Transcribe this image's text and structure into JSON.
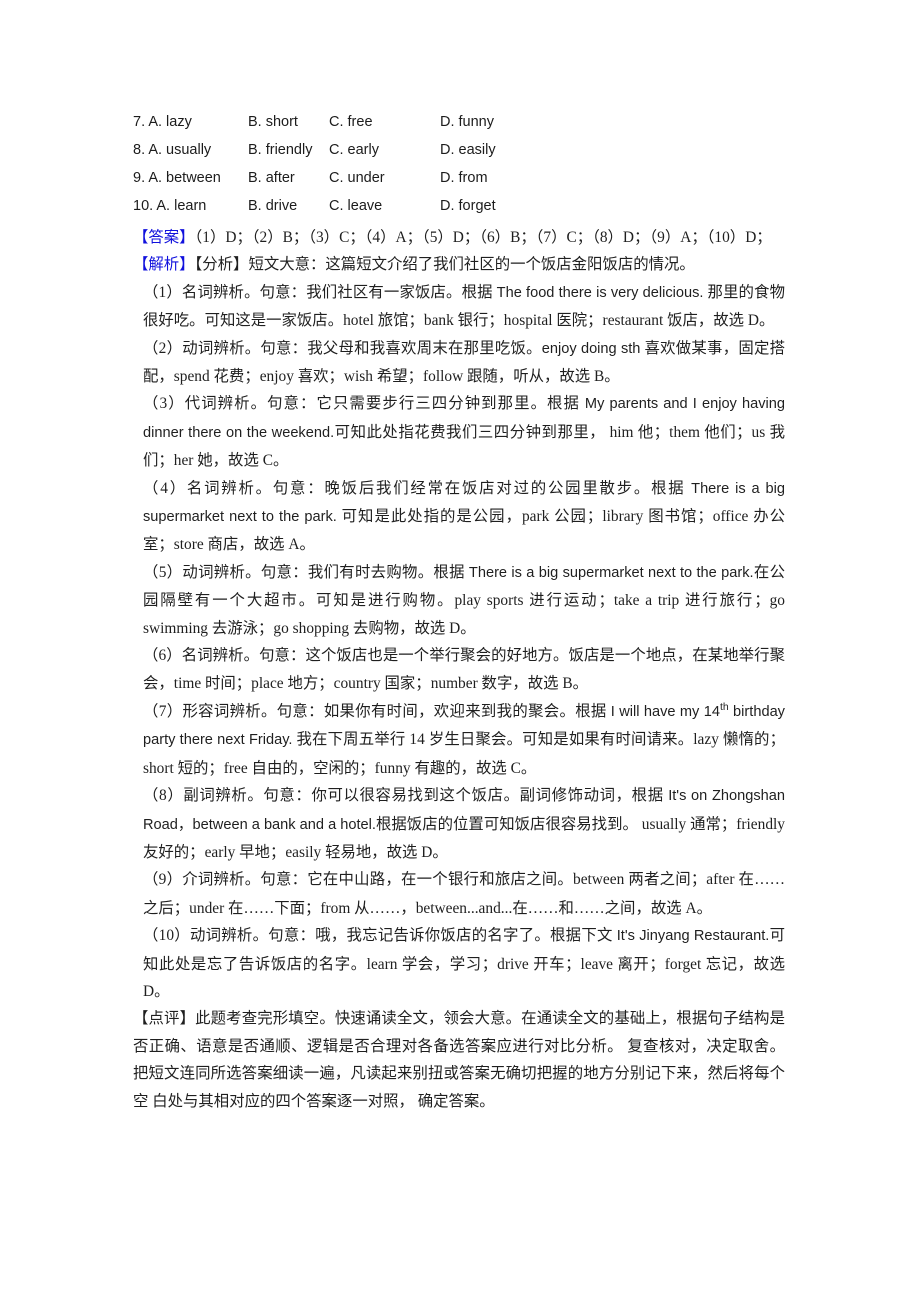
{
  "document": {
    "type": "english-cloze-answer-key",
    "accent_color": "#1111dd",
    "body_color": "#1f1f1f"
  },
  "choices": {
    "rows": [
      {
        "a": "7. A. lazy",
        "b": "B. short",
        "c": "C. free",
        "d": "D. funny"
      },
      {
        "a": "8. A. usually",
        "b": "B. friendly",
        "c": "C. early",
        "d": "D. easily"
      },
      {
        "a": "9. A. between",
        "b": "B. after",
        "c": "C. under",
        "d": "D. from"
      },
      {
        "a": "10. A. learn",
        "b": "B. drive",
        "c": "C. leave",
        "d": "D. forget"
      }
    ]
  },
  "answer_section": {
    "marker": "【答案】",
    "text": "（1）D；（2）B；（3）C；（4）A；（5）D；（6）B；（7）C；（8）D；（9）A；（10）D；"
  },
  "analysis_section": {
    "marker": "【解析】",
    "sub_marker": "【分析】",
    "summary": "短文大意：这篇短文介绍了我们社区的一个饭店金阳饭店的情况。",
    "items": [
      {
        "number": "（1）",
        "text_before": "名词辨析。句意：我们社区有一家饭店。根据 ",
        "quote": "The food there is very delicious.",
        "text_after": " 那里的食物很好吃。可知这是一家饭店。hotel 旅馆；bank 银行；hospital 医院；restaurant 饭店，故选 D。"
      },
      {
        "number": "（2）",
        "text_before": "动词辨析。句意：我父母和我喜欢周末在那里吃饭。",
        "quote": "enjoy doing sth",
        "text_after": " 喜欢做某事，固定搭配，spend 花费；enjoy 喜欢；wish 希望；follow 跟随，听从，故选 B。"
      },
      {
        "number": "（3）",
        "text_before": "代词辨析。句意：它只需要步行三四分钟到那里。根据 ",
        "quote": "My parents and I enjoy having dinner there on the weekend.",
        "text_after": "可知此处指花费我们三四分钟到那里， him 他；them 他们；us 我们；her 她，故选 C。"
      },
      {
        "number": "（4）",
        "text_before": "名词辨析。句意：晚饭后我们经常在饭店对过的公园里散步。根据 ",
        "quote": "There is a big supermarket next to the park.",
        "text_after": " 可知是此处指的是公园，park 公园；library 图书馆；office 办公室；store 商店，故选 A。"
      },
      {
        "number": "（5）",
        "text_before": "动词辨析。句意：我们有时去购物。根据 ",
        "quote": "There is a big supermarket next to the park.",
        "text_after": "在公园隔壁有一个大超市。可知是进行购物。play sports 进行运动；take a trip 进行旅行；go swimming 去游泳；go shopping 去购物，故选 D。"
      },
      {
        "number": "（6）",
        "text_before": "名词辨析。句意：这个饭店也是一个举行聚会的好地方。饭店是一个地点，在某地举行聚会，",
        "quote": "",
        "text_after": "time 时间；place 地方；country 国家；number 数字，故选 B。"
      },
      {
        "number": "（7）",
        "text_before": "形容词辨析。句意：如果你有时间，欢迎来到我的聚会。根据 ",
        "quote_pre": "I will have my 14",
        "quote_sup": "th",
        "quote_post": " birthday party there next Friday.",
        "text_after": " 我在下周五举行 14 岁生日聚会。可知是如果有时间请来。lazy 懒惰的；short 短的；free 自由的，空闲的；funny 有趣的，故选 C。"
      },
      {
        "number": "（8）",
        "text_before": "副词辨析。句意：你可以很容易找到这个饭店。副词修饰动词，根据 ",
        "quote": "It's on Zhongshan Road，between a bank and a hotel.",
        "text_after": "根据饭店的位置可知饭店很容易找到。 usually 通常；friendly 友好的；early 早地；easily 轻易地，故选 D。"
      },
      {
        "number": "（9）",
        "text_before": "介词辨析。句意：它在中山路，在一个银行和旅店之间。",
        "quote": "",
        "text_after": "between 两者之间；after 在……之后；under 在……下面；from 从……，between...and...在……和……之间，故选 A。"
      },
      {
        "number": "（10）",
        "text_before": "动词辨析。句意：哦，我忘记告诉你饭店的名字了。根据下文 ",
        "quote": "It's Jinyang Restaurant.",
        "text_after": "可知此处是忘了告诉饭店的名字。learn 学会，学习；drive 开车；leave 离开；forget 忘记，故选 D。"
      }
    ]
  },
  "comment_section": {
    "marker": "【点评】",
    "text": "此题考查完形填空。快速诵读全文，领会大意。在通读全文的基础上，根据句子结构是否正确、语意是否通顺、逻辑是否合理对各备选答案应进行对比分析。 复查核对，决定取舍。 把短文连同所选答案细读一遍，凡读起来别扭或答案无确切把握的地方分别记下来，然后将每个空 白处与其相对应的四个答案逐一对照， 确定答案。"
  }
}
